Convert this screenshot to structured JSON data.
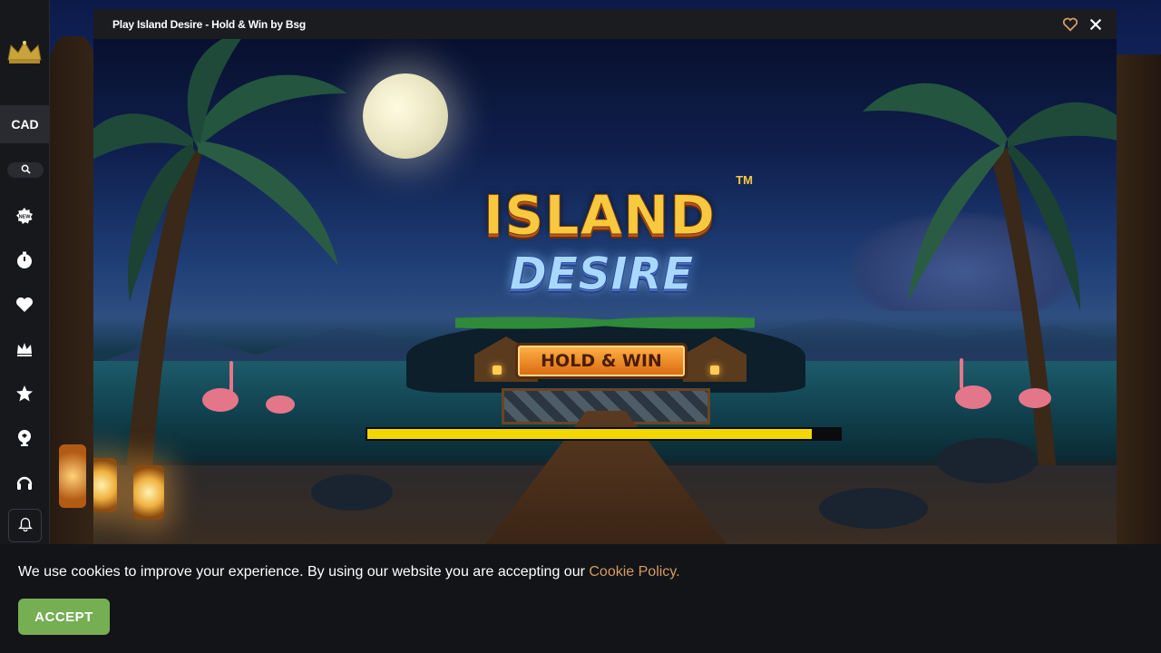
{
  "sidebar": {
    "logo_icon": "crown-logo",
    "currency": "CAD",
    "items": [
      {
        "icon": "new-badge-icon"
      },
      {
        "icon": "stopwatch-icon"
      },
      {
        "icon": "heart-icon"
      },
      {
        "icon": "crown-icon"
      },
      {
        "icon": "star-icon"
      },
      {
        "icon": "trophy-icon"
      },
      {
        "icon": "headset-icon"
      },
      {
        "icon": "bell-icon"
      }
    ]
  },
  "modal": {
    "title": "Play Island Desire - Hold & Win by Bsg",
    "favorite_icon": "heart-outline-icon",
    "close_icon": "close-icon",
    "accent_color": "#d39c62"
  },
  "game": {
    "logo_line1": "ISLAND",
    "logo_line2": "DESIRE",
    "logo_tm": "TM",
    "badge": "HOLD & WIN",
    "loading_progress": 0.94,
    "progress_color": "#f3d700"
  },
  "cookie": {
    "text": "We use cookies to improve your experience. By using our website you are accepting our ",
    "link": "Cookie Policy.",
    "accept_label": "ACCEPT",
    "accept_color": "#75ae53"
  }
}
